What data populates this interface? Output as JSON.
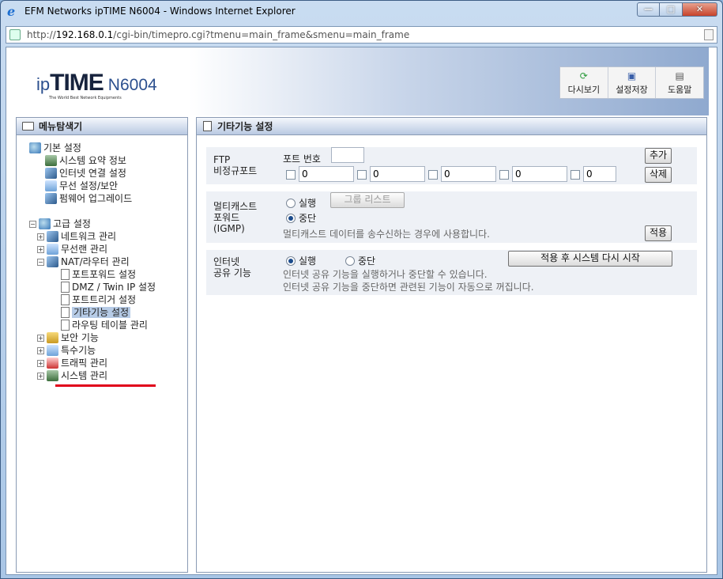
{
  "window": {
    "title": "EFM Networks ipTIME N6004 - Windows Internet Explorer",
    "url_prefix": "http://",
    "url_host": "192.168.0.1",
    "url_rest": "/cgi-bin/timepro.cgi?tmenu=main_frame&smenu=main_frame",
    "min_glyph": "—",
    "max_glyph": "□",
    "close_glyph": "✕"
  },
  "header": {
    "logo_ip": "ip",
    "logo_time": "TIME",
    "logo_model": "N6004",
    "logo_tagline": "The World Best Network Equipments",
    "buttons": [
      {
        "label": "다시보기",
        "icon": "refresh-icon",
        "glyph": "⟳"
      },
      {
        "label": "설정저장",
        "icon": "save-icon",
        "glyph": "▣"
      },
      {
        "label": "도움말",
        "icon": "help-book-icon",
        "glyph": "▤"
      }
    ]
  },
  "sidebar": {
    "title": "메뉴탐색기",
    "basic": {
      "label": "기본 설정",
      "items": [
        "시스템 요약 정보",
        "인터넷 연결 설정",
        "무선 설정/보안",
        "펌웨어 업그레이드"
      ]
    },
    "advanced": {
      "label": "고급 설정",
      "groups": [
        "네트워크 관리",
        "무선랜 관리",
        "NAT/라우터 관리"
      ],
      "nat_items": [
        "포트포워드 설정",
        "DMZ / Twin IP 설정",
        "포트트리거 설정",
        "기타기능 설정",
        "라우팅 테이블 관리"
      ],
      "more_groups": [
        "보안 기능",
        "특수기능",
        "트래픽 관리",
        "시스템 관리"
      ]
    }
  },
  "main": {
    "title": "기타기능 설정",
    "ftp": {
      "label_line1": "FTP",
      "label_line2": "비정규포트",
      "port_label": "포트 번호",
      "port_value": "",
      "ports": [
        "0",
        "0",
        "0",
        "0",
        "0"
      ],
      "add_label": "추가",
      "delete_label": "삭제"
    },
    "multicast": {
      "label_line1": "멀티캐스트",
      "label_line2": "포워드",
      "label_line3": "(IGMP)",
      "run_label": "실행",
      "stop_label": "중단",
      "group_list_label": "그룹 리스트",
      "help": "멀티캐스트 데이터를 송수신하는 경우에 사용합니다.",
      "apply_label": "적용",
      "selected": "stop"
    },
    "sharing": {
      "label_line1": "인터넷",
      "label_line2": "공유 기능",
      "run_label": "실행",
      "stop_label": "중단",
      "apply_restart_label": "적용 후 시스템 다시 시작",
      "help1": "인터넷 공유 기능을 실행하거나 중단할 수 있습니다.",
      "help2": "인터넷 공유 기능을 중단하면 관련된 기능이 자동으로 꺼집니다.",
      "selected": "run"
    }
  }
}
